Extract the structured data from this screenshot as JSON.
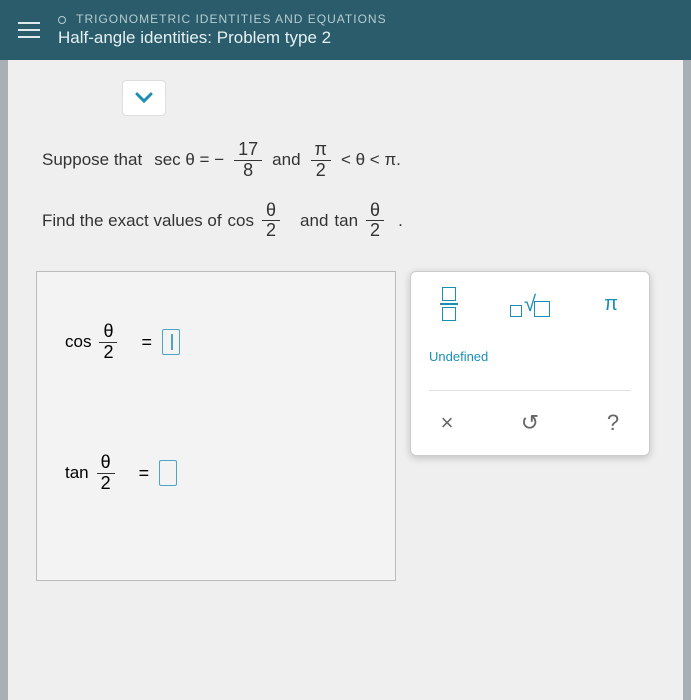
{
  "header": {
    "breadcrumb": "TRIGONOMETRIC IDENTITIES AND EQUATIONS",
    "title": "Half-angle identities: Problem type 2"
  },
  "problem": {
    "p1_a": "Suppose that",
    "sec": "sec θ = −",
    "frac1_num": "17",
    "frac1_den": "8",
    "and1": "and",
    "frac2_num": "π",
    "frac2_den": "2",
    "ineq": "< θ < π.",
    "p2_a": "Find the exact values of",
    "cos": "cos",
    "tan": "tan",
    "theta": "θ",
    "two": "2",
    "and2": "and",
    "period": "."
  },
  "answers": {
    "cos_label": "cos",
    "tan_label": "tan",
    "theta": "θ",
    "two": "2",
    "eq": "="
  },
  "toolbox": {
    "pi": "π",
    "undefined": "Undefined",
    "clear": "×",
    "reset": "↺",
    "help": "?"
  }
}
